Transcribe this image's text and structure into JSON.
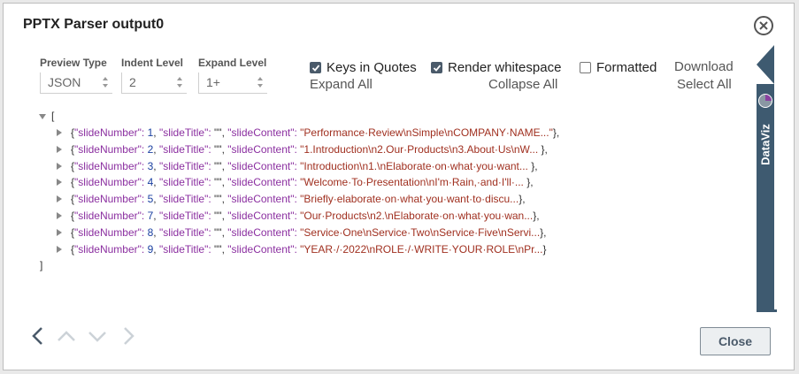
{
  "dialog": {
    "title": "PPTX Parser output0",
    "close_label": "Close"
  },
  "controls": {
    "preview_type": {
      "label": "Preview Type",
      "value": "JSON"
    },
    "indent_level": {
      "label": "Indent Level",
      "value": "2"
    },
    "expand_level": {
      "label": "Expand Level",
      "value": "1+"
    },
    "keys_in_quotes": {
      "label": "Keys in Quotes",
      "checked": true
    },
    "render_whitespace": {
      "label": "Render whitespace",
      "checked": true
    },
    "formatted": {
      "label": "Formatted",
      "checked": false
    },
    "download": "Download",
    "expand_all": "Expand All",
    "collapse_all": "Collapse All",
    "select_all": "Select All"
  },
  "json": {
    "open": "[",
    "close": "]",
    "rows": [
      {
        "slideNumber": "1",
        "slideContent": "\"Performance·Review\\nSimple\\nCOMPANY·NAME...\"",
        "end": "},"
      },
      {
        "slideNumber": "2",
        "slideContent": "\"1.Introduction\\n2.Our·Products\\n3.About·Us\\nW...",
        "end": " },"
      },
      {
        "slideNumber": "3",
        "slideContent": "\"Introduction\\n1.\\nElaborate·on·what·you·want...",
        "end": " },"
      },
      {
        "slideNumber": "4",
        "slideContent": "\"Welcome·To·Presentation\\nI'm·Rain,·and·I'll·...",
        "end": " },"
      },
      {
        "slideNumber": "5",
        "slideContent": "\"Briefly·elaborate·on·what·you·want·to·discu...",
        "end": "},"
      },
      {
        "slideNumber": "7",
        "slideContent": "\"Our·Products\\n2.\\nElaborate·on·what·you·wan...",
        "end": "},"
      },
      {
        "slideNumber": "8",
        "slideContent": "\"Service·One\\nService·Two\\nService·Five\\nServi...",
        "end": "},"
      },
      {
        "slideNumber": "9",
        "slideContent": "\"YEAR·/·2022\\nROLE·/·WRITE·YOUR·ROLE\\nPr...",
        "end": "}"
      }
    ],
    "key_slide_number": "\"slideNumber\":",
    "key_slide_title": "\"slideTitle\":",
    "key_slide_content": "\"slideContent\":",
    "slide_title_value": "\"\","
  },
  "sidebar": {
    "label": "DataViz"
  },
  "colors": {
    "key": "#8b2fa0",
    "number": "#1a3fa0",
    "string": "#a03020",
    "sidebar": "#3e5a70"
  }
}
